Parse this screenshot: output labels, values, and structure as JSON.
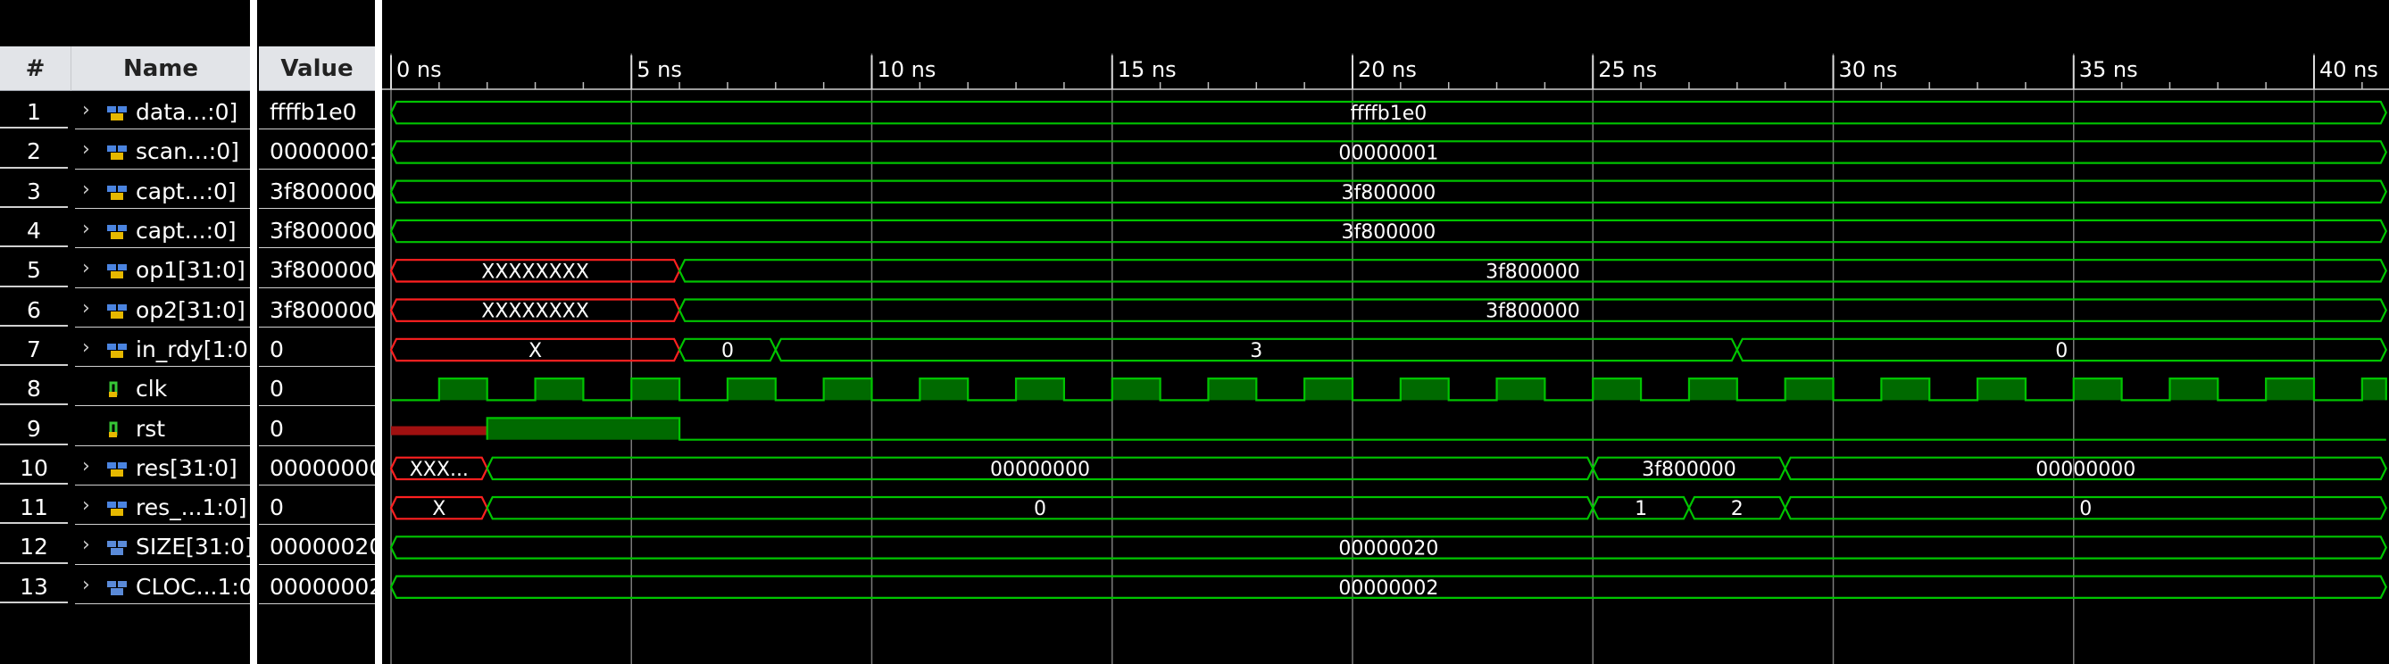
{
  "header": {
    "index": "#",
    "name": "Name",
    "value": "Value"
  },
  "timeline": {
    "ticks": [
      "0 ns",
      "5 ns",
      "10 ns",
      "15 ns",
      "20 ns",
      "25 ns",
      "30 ns",
      "35 ns",
      "40 ns"
    ]
  },
  "colors": {
    "background": "#000000",
    "wave": "#00c400",
    "clk_fill": "#006a00",
    "unknown": "#ff2020",
    "text": "#ffffff"
  },
  "signals": [
    {
      "index": "1",
      "name": "data...:0]",
      "value": "ffffb1e0",
      "type": "bus",
      "icon": "bus-signal-icon"
    },
    {
      "index": "2",
      "name": "scan...:0]",
      "value": "00000001",
      "type": "bus",
      "icon": "bus-signal-icon"
    },
    {
      "index": "3",
      "name": "capt...:0]",
      "value": "3f800000",
      "type": "bus",
      "icon": "bus-signal-icon"
    },
    {
      "index": "4",
      "name": "capt...:0]",
      "value": "3f800000",
      "type": "bus",
      "icon": "bus-signal-icon"
    },
    {
      "index": "5",
      "name": "op1[31:0]",
      "value": "3f800000",
      "type": "bus",
      "icon": "bus-signal-icon"
    },
    {
      "index": "6",
      "name": "op2[31:0]",
      "value": "3f800000",
      "type": "bus",
      "icon": "bus-signal-icon"
    },
    {
      "index": "7",
      "name": "in_rdy[1:0]",
      "value": "0",
      "type": "bus",
      "icon": "bus-signal-icon"
    },
    {
      "index": "8",
      "name": "clk",
      "value": "0",
      "type": "bit",
      "icon": "bit-signal-icon"
    },
    {
      "index": "9",
      "name": "rst",
      "value": "0",
      "type": "bit",
      "icon": "bit-signal-icon"
    },
    {
      "index": "10",
      "name": "res[31:0]",
      "value": "00000000",
      "type": "bus",
      "icon": "bus-signal-icon"
    },
    {
      "index": "11",
      "name": "res_...1:0]",
      "value": "0",
      "type": "bus",
      "icon": "bus-signal-icon"
    },
    {
      "index": "12",
      "name": "SIZE[31:0]",
      "value": "00000020",
      "type": "bus",
      "icon": "param-signal-icon"
    },
    {
      "index": "13",
      "name": "CLOC...1:0",
      "value": "00000002",
      "type": "bus",
      "icon": "param-signal-icon"
    }
  ],
  "waves": [
    {
      "segments": [
        {
          "t0": 0,
          "t1": 41.5,
          "label": "ffffb1e0"
        }
      ]
    },
    {
      "segments": [
        {
          "t0": 0,
          "t1": 41.5,
          "label": "00000001"
        }
      ]
    },
    {
      "segments": [
        {
          "t0": 0,
          "t1": 41.5,
          "label": "3f800000"
        }
      ]
    },
    {
      "segments": [
        {
          "t0": 0,
          "t1": 41.5,
          "label": "3f800000"
        }
      ]
    },
    {
      "segments": [
        {
          "t0": 0,
          "t1": 6,
          "label": "XXXXXXXX",
          "unknown": true
        },
        {
          "t0": 6,
          "t1": 41.5,
          "label": "3f800000"
        }
      ]
    },
    {
      "segments": [
        {
          "t0": 0,
          "t1": 6,
          "label": "XXXXXXXX",
          "unknown": true
        },
        {
          "t0": 6,
          "t1": 41.5,
          "label": "3f800000"
        }
      ]
    },
    {
      "segments": [
        {
          "t0": 0,
          "t1": 6,
          "label": "X",
          "unknown": true
        },
        {
          "t0": 6,
          "t1": 8,
          "label": "0"
        },
        {
          "t0": 8,
          "t1": 28,
          "label": "3"
        },
        {
          "t0": 28,
          "t1": 41.5,
          "label": "0"
        }
      ]
    },
    {
      "clock": {
        "period": 2,
        "first_rise": 1,
        "end": 41.5
      }
    },
    {
      "bit": {
        "initial_unknown_until": 2,
        "high_from": 2,
        "high_until": 6,
        "end": 41.5
      }
    },
    {
      "segments": [
        {
          "t0": 0,
          "t1": 2,
          "label": "XXX...",
          "unknown": true
        },
        {
          "t0": 2,
          "t1": 25,
          "label": "00000000"
        },
        {
          "t0": 25,
          "t1": 29,
          "label": "3f800000"
        },
        {
          "t0": 29,
          "t1": 41.5,
          "label": "00000000"
        }
      ]
    },
    {
      "segments": [
        {
          "t0": 0,
          "t1": 2,
          "label": "X",
          "unknown": true
        },
        {
          "t0": 2,
          "t1": 25,
          "label": "0"
        },
        {
          "t0": 25,
          "t1": 27,
          "label": "1"
        },
        {
          "t0": 27,
          "t1": 29,
          "label": "2"
        },
        {
          "t0": 29,
          "t1": 41.5,
          "label": "0"
        }
      ]
    },
    {
      "segments": [
        {
          "t0": 0,
          "t1": 41.5,
          "label": "00000020"
        }
      ]
    },
    {
      "segments": [
        {
          "t0": 0,
          "t1": 41.5,
          "label": "00000002"
        }
      ]
    }
  ]
}
